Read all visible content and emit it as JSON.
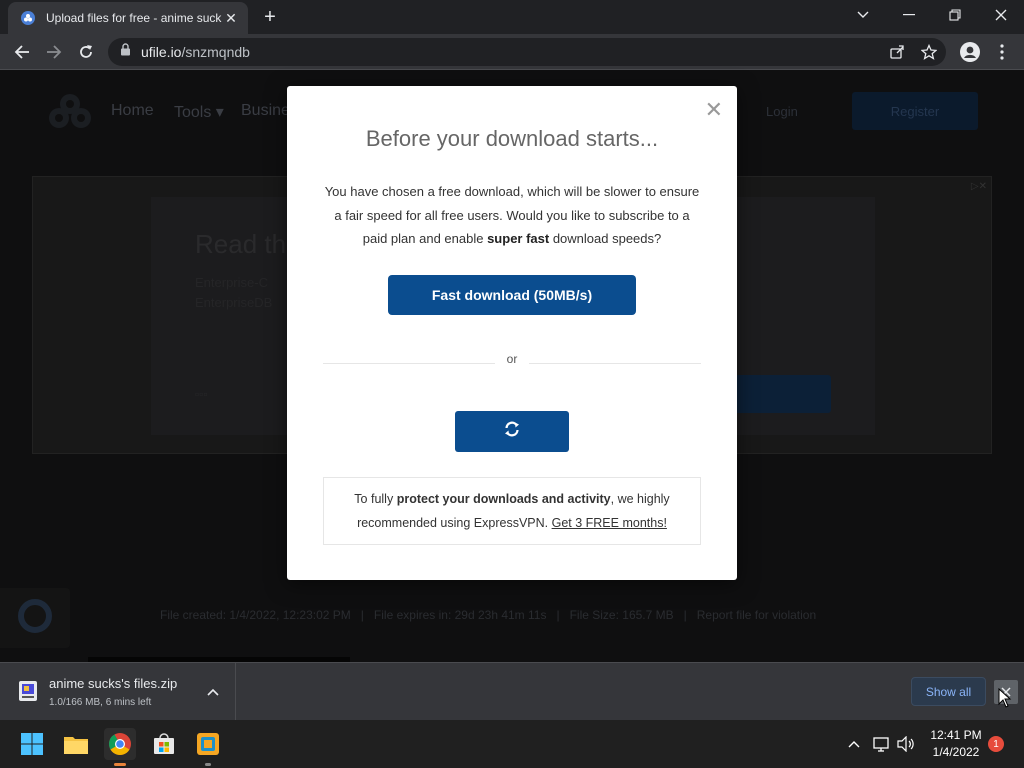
{
  "browser": {
    "tab_title": "Upload files for free - anime suck",
    "url_domain": "ufile.io",
    "url_path": "/snzmqndb"
  },
  "site": {
    "nav_home": "Home",
    "nav_tools": "Tools ▾",
    "nav_business": "Busine",
    "login": "Login",
    "register": "Register",
    "ad_headline": "Read th",
    "ad_body_line1": "Enterprise-C",
    "ad_body_line2": "EnterpriseDB",
    "file_created": "File created: 1/4/2022, 12:23:02 PM",
    "file_expires": "File expires in: 29d 23h 41m 11s",
    "file_size": "File Size: 165.7 MB",
    "report": "Report file for violation"
  },
  "modal": {
    "title": "Before your download starts...",
    "text_before": "You have chosen a free download, which will be slower to ensure a fair speed for all free users. Would you like to subscribe to a paid plan and enable ",
    "text_bold": "super fast",
    "text_after": " download speeds?",
    "fast_button": "Fast download (50MB/s)",
    "or": "or",
    "vpn_before": "To fully ",
    "vpn_bold": "protect your downloads and activity",
    "vpn_middle": ", we highly recommended using ExpressVPN. ",
    "vpn_link": "Get 3 FREE months!"
  },
  "download_shelf": {
    "file_name": "anime sucks's files.zip",
    "status": "1.0/166 MB, 6 mins left",
    "show_all": "Show all"
  },
  "taskbar": {
    "time": "12:41 PM",
    "date": "1/4/2022",
    "notification_count": "1"
  },
  "colors": {
    "accent_blue": "#0b4d8f",
    "chrome_dark": "#202124",
    "chrome_toolbar": "#35363a"
  }
}
